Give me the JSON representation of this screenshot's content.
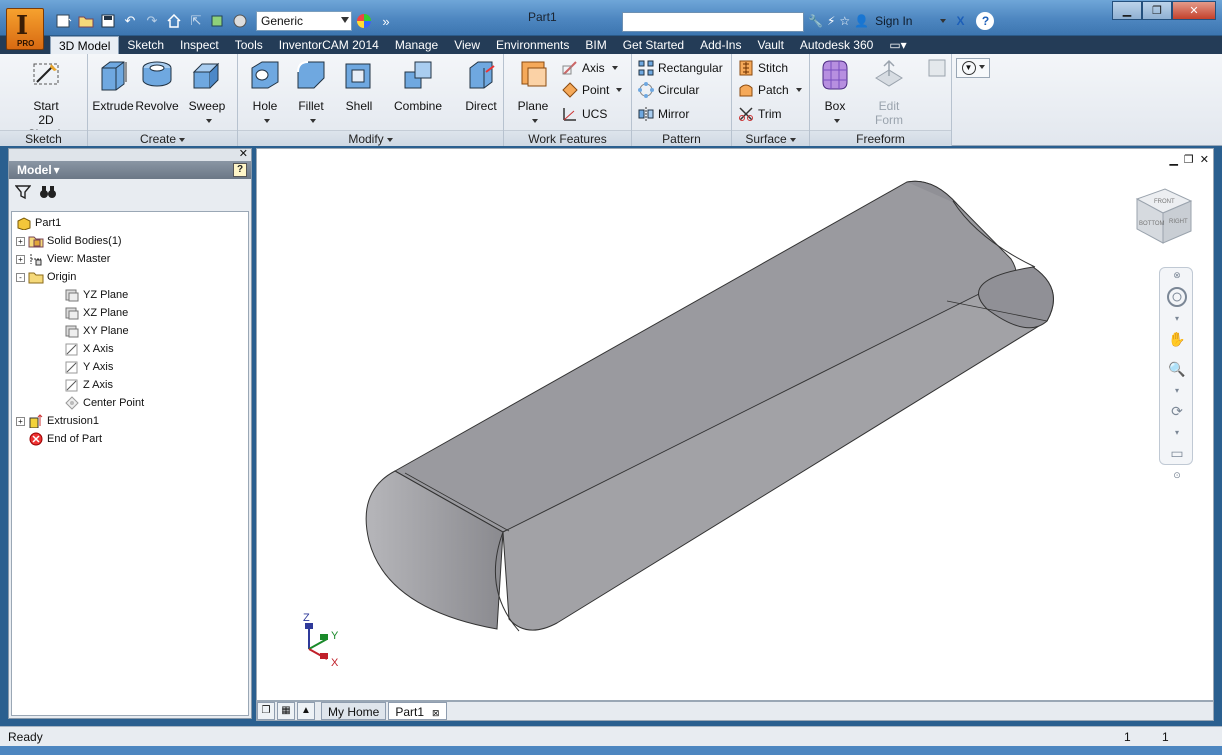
{
  "app": {
    "logo_letter": "I",
    "logo_badge": "PRO",
    "document_title": "Part1",
    "material": "Generic",
    "sign_in": "Sign In",
    "help": "?"
  },
  "tabs": [
    "3D Model",
    "Sketch",
    "Inspect",
    "Tools",
    "InventorCAM 2014",
    "Manage",
    "View",
    "Environments",
    "BIM",
    "Get Started",
    "Add-Ins",
    "Vault",
    "Autodesk 360"
  ],
  "ribbon": {
    "sketch": {
      "title": "Sketch",
      "start_sketch": [
        "Start",
        "2D Sketch"
      ]
    },
    "create": {
      "title": "Create",
      "extrude": "Extrude",
      "revolve": "Revolve",
      "sweep": "Sweep"
    },
    "modify": {
      "title": "Modify",
      "hole": "Hole",
      "fillet": "Fillet",
      "shell": "Shell",
      "combine": "Combine",
      "direct": "Direct"
    },
    "work_features": {
      "title": "Work Features",
      "plane": "Plane",
      "axis": "Axis",
      "point": "Point",
      "ucs": "UCS"
    },
    "pattern": {
      "title": "Pattern",
      "rectangular": "Rectangular",
      "circular": "Circular",
      "mirror": "Mirror"
    },
    "surface": {
      "title": "Surface",
      "stitch": "Stitch",
      "patch": "Patch",
      "trim": "Trim"
    },
    "freeform": {
      "title": "Freeform",
      "box": "Box",
      "edit_form": [
        "Edit",
        "Form"
      ]
    }
  },
  "browser": {
    "title": "Model",
    "help_label": "?",
    "tree": [
      {
        "label": "Part1",
        "level": 0,
        "icon": "part-icon",
        "toggle": ""
      },
      {
        "label": "Solid Bodies(1)",
        "level": 1,
        "icon": "solid-bodies-icon",
        "toggle": "+"
      },
      {
        "label": "View: Master",
        "level": 1,
        "icon": "view-icon",
        "toggle": "+"
      },
      {
        "label": "Origin",
        "level": 1,
        "icon": "folder-icon",
        "toggle": "-"
      },
      {
        "label": "YZ Plane",
        "level": 2,
        "icon": "plane-icon",
        "toggle": ""
      },
      {
        "label": "XZ Plane",
        "level": 2,
        "icon": "plane-icon",
        "toggle": ""
      },
      {
        "label": "XY Plane",
        "level": 2,
        "icon": "plane-icon",
        "toggle": ""
      },
      {
        "label": "X Axis",
        "level": 2,
        "icon": "axis-icon",
        "toggle": ""
      },
      {
        "label": "Y Axis",
        "level": 2,
        "icon": "axis-icon",
        "toggle": ""
      },
      {
        "label": "Z Axis",
        "level": 2,
        "icon": "axis-icon",
        "toggle": ""
      },
      {
        "label": "Center Point",
        "level": 2,
        "icon": "center-point-icon",
        "toggle": ""
      },
      {
        "label": "Extrusion1",
        "level": 1,
        "icon": "extrusion-icon",
        "toggle": "+"
      },
      {
        "label": "End of Part",
        "level": 1,
        "icon": "end-of-part-icon",
        "toggle": ""
      }
    ]
  },
  "viewport": {
    "axis_labels": {
      "z": "Z",
      "y": "Y",
      "x": "X"
    },
    "viewcube": {
      "front": "FRONT",
      "right": "RIGHT",
      "bottom": "BOTTOM"
    }
  },
  "doc_tabs": [
    "My Home",
    "Part1"
  ],
  "status": {
    "text": "Ready",
    "num1": "1",
    "num2": "1"
  }
}
